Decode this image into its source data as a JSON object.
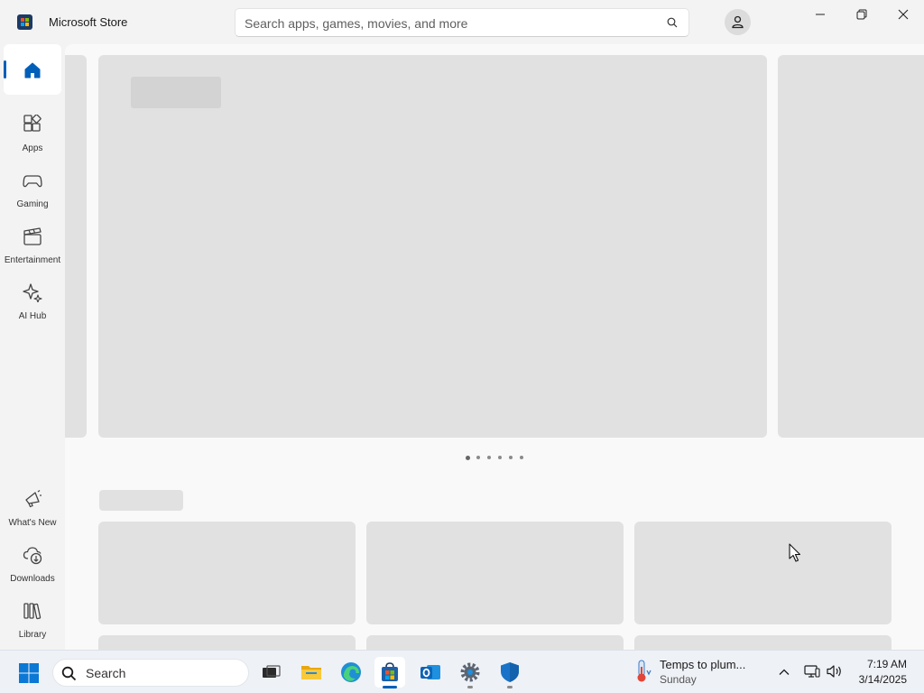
{
  "window": {
    "app_title": "Microsoft Store",
    "icon": "microsoft-store-icon",
    "controls": [
      "minimize-icon",
      "restore-icon",
      "close-icon"
    ]
  },
  "search": {
    "placeholder": "Search apps, games, movies, and more",
    "value": ""
  },
  "sidebar": {
    "items": [
      {
        "label": "",
        "icon": "home-icon",
        "selected": true
      },
      {
        "label": "Apps",
        "icon": "apps-icon"
      },
      {
        "label": "Gaming",
        "icon": "gamepad-icon"
      },
      {
        "label": "Entertainment",
        "icon": "clapperboard-icon"
      },
      {
        "label": "AI Hub",
        "icon": "sparkle-icon"
      }
    ],
    "bottom_items": [
      {
        "label": "What's New",
        "icon": "megaphone-icon"
      },
      {
        "label": "Downloads",
        "icon": "cloud-download-icon"
      },
      {
        "label": "Library",
        "icon": "library-icon"
      }
    ]
  },
  "carousel": {
    "dot_count": 6,
    "active_dot": 1
  },
  "taskbar": {
    "search_label": "Search",
    "apps": [
      {
        "name": "Task View",
        "icon": "task-view-icon"
      },
      {
        "name": "File Explorer",
        "icon": "folder-icon"
      },
      {
        "name": "Microsoft Edge",
        "icon": "edge-icon"
      },
      {
        "name": "Microsoft Store",
        "icon": "store-icon",
        "active": true
      },
      {
        "name": "Outlook",
        "icon": "outlook-icon"
      },
      {
        "name": "Settings",
        "icon": "settings-gear-icon",
        "running": true
      },
      {
        "name": "Windows Security",
        "icon": "shield-icon",
        "running": true
      }
    ],
    "weather": {
      "title": "Temps to plum...",
      "subtitle": "Sunday"
    },
    "clock": {
      "time": "7:19 AM",
      "date": "3/14/2025"
    }
  },
  "colors": {
    "accent": "#005fb8",
    "skeleton": "#e1e1e1",
    "background": "#f3f3f3"
  }
}
